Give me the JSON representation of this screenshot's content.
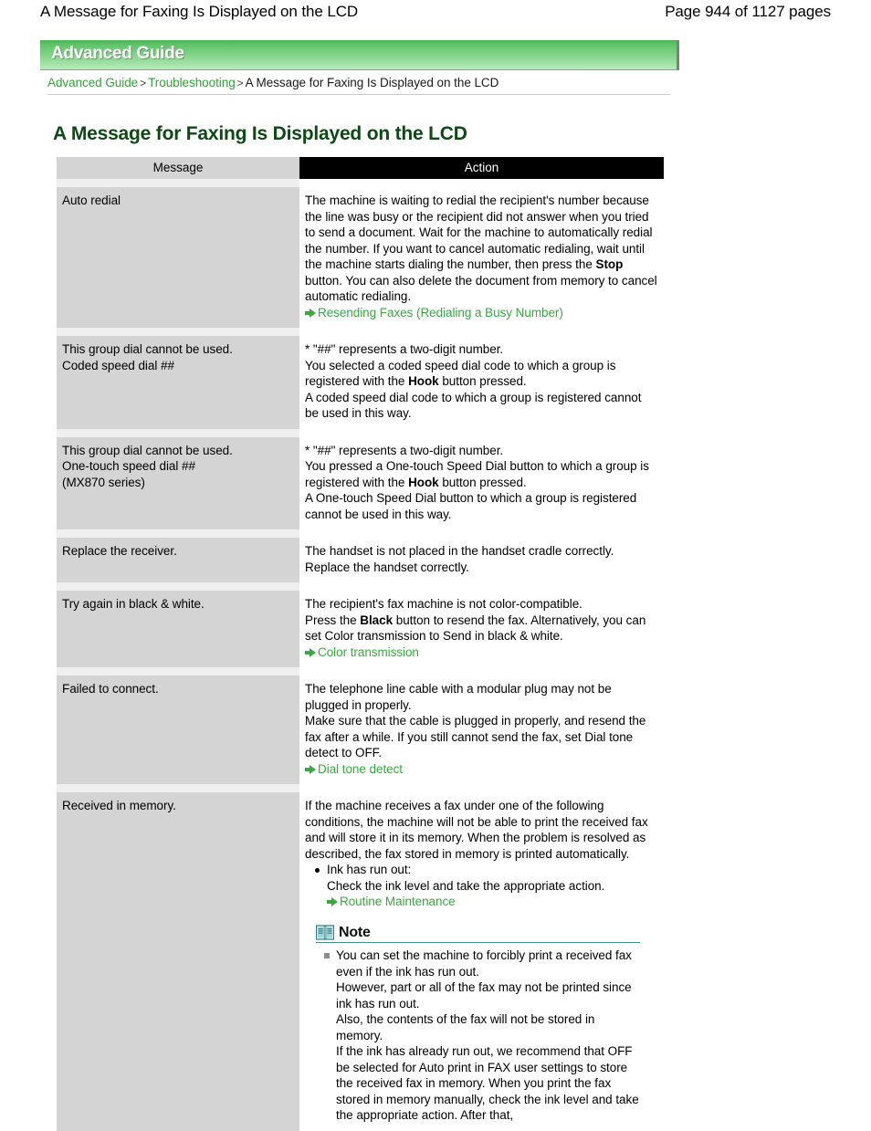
{
  "page_header": {
    "title": "A Message for Faxing Is Displayed on the LCD",
    "pages": "Page 944 of 1127 pages"
  },
  "banner": {
    "title": "Advanced Guide",
    "gradient_top": "#4cb757",
    "gradient_bottom": "#b9ebbc"
  },
  "breadcrumb": {
    "item1": "Advanced Guide",
    "sep1": ">",
    "item2": "Troubleshooting",
    "sep2": ">",
    "current": "A Message for Faxing Is Displayed on the LCD",
    "link_color": "#36a03c"
  },
  "doc_title": "A Message for Faxing Is Displayed on the LCD",
  "table": {
    "headers": {
      "message": "Message",
      "action": "Action"
    },
    "rows": [
      {
        "message_lines": [
          "Auto redial"
        ],
        "action_p1_a": "The machine is waiting to redial the recipient's number because the line was busy or the recipient did not answer when you tried to send a document. Wait for the machine to automatically redial the number. If you want to cancel automatic redialing, wait until the machine starts dialing the number, then press the ",
        "action_bold": "Stop",
        "action_p1_b": " button. You can also delete the document from memory to cancel automatic redialing.",
        "link": "Resending Faxes (Redialing a Busy Number)"
      },
      {
        "message_lines": [
          "This group dial cannot be used.",
          "Coded speed dial ##"
        ],
        "action_p1": "* \"##\" represents a two-digit number.",
        "action_p2_a": "You selected a coded speed dial code to which a group is registered with the ",
        "action_bold": "Hook",
        "action_p2_b": " button pressed.",
        "action_p3": "A coded speed dial code to which a group is registered cannot be used in this way."
      },
      {
        "message_lines": [
          "This group dial cannot be used.",
          "One-touch speed dial ##",
          "(MX870 series)"
        ],
        "action_p1": "* \"##\" represents a two-digit number.",
        "action_p2_a": "You pressed a One-touch Speed Dial button to which a group is registered with the ",
        "action_bold": "Hook",
        "action_p2_b": " button pressed.",
        "action_p3": "A One-touch Speed Dial button to which a group is registered cannot be used in this way."
      },
      {
        "message_lines": [
          "Replace the receiver."
        ],
        "action_p1": "The handset is not placed in the handset cradle correctly.",
        "action_p2": "Replace the handset correctly."
      },
      {
        "message_lines": [
          "Try again in black & white."
        ],
        "action_p1": "The recipient's fax machine is not color-compatible.",
        "action_p2_a": "Press the ",
        "action_bold": "Black",
        "action_p2_b": " button to resend the fax. Alternatively, you can set Color transmission to Send in black & white.",
        "link": "Color transmission"
      },
      {
        "message_lines": [
          "Failed to connect."
        ],
        "action_p1": "The telephone line cable with a modular plug may not be plugged in properly.",
        "action_p2": "Make sure that the cable is plugged in properly, and resend the fax after a while. If you still cannot send the fax, set Dial tone detect to OFF.",
        "link": "Dial tone detect"
      },
      {
        "message_lines": [
          "Received in memory."
        ],
        "action_p1": "If the machine receives a fax under one of the following conditions, the machine will not be able to print the received fax and will store it in its memory. When the problem is resolved as described, the fax stored in memory is printed automatically.",
        "bullet_title": "Ink has run out:",
        "bullet_text": "Check the ink level and take the appropriate action.",
        "bullet_link": "Routine Maintenance",
        "note": {
          "label": "Note",
          "icon": "book-icon",
          "rule_color": "#3f8e96",
          "items": [
            "You can set the machine to forcibly print a received fax even if the ink has run out.",
            "However, part or all of the fax may not be printed since ink has run out.",
            "Also, the contents of the fax will not be stored in memory.",
            "If the ink has already run out, we recommend that OFF be selected for Auto print in FAX user settings to store the received fax in memory. When you print the fax stored in memory manually, check the ink level and take the appropriate action. After that,"
          ]
        }
      }
    ]
  }
}
